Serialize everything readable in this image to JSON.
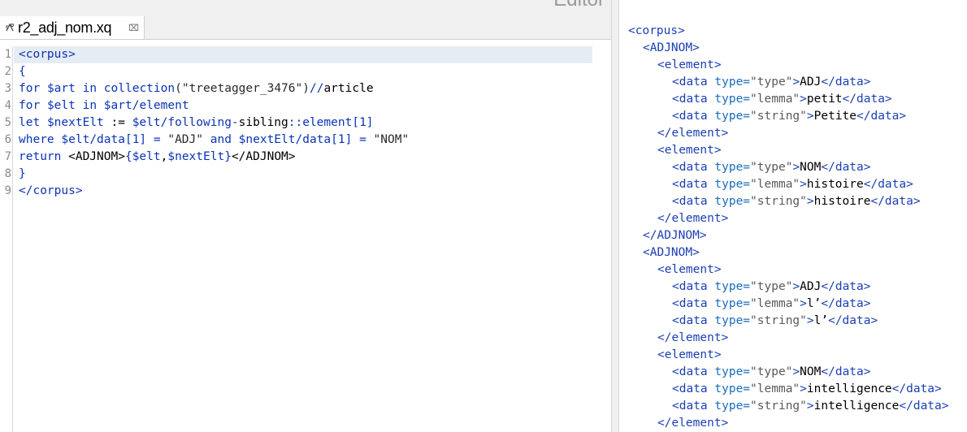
{
  "view_title": "Editor",
  "tab": {
    "label": "r2_adj_nom.xq",
    "close_glyph": "⌧"
  },
  "gutter_numbers": [
    "1",
    "2",
    "3",
    "4",
    "5",
    "6",
    "7",
    "8",
    "9"
  ],
  "code": {
    "l1": {
      "a": "<corpus>"
    },
    "l2": {
      "a": "{"
    },
    "l3": {
      "a": "for",
      "b": " ",
      "c": "$art",
      "d": " ",
      "e": "in",
      "f": " ",
      "g": "collection",
      "h": "(\"treetagger_3476\")",
      "i": "//",
      "j": "article"
    },
    "l4": {
      "a": "for",
      "b": " ",
      "c": "$elt",
      "d": " ",
      "e": "in",
      "f": " ",
      "g": "$art",
      "h": "/",
      "i": "element"
    },
    "l5": {
      "a": "let",
      "b": " ",
      "c": "$nextElt",
      "d": " := ",
      "e": "$elt",
      "f": "/following-",
      "g": "sibling",
      "h": "::element[1]"
    },
    "l6": {
      "a": "where",
      "b": " ",
      "c": "$elt",
      "d": "/data[1] = ",
      "e": "\"ADJ\"",
      "f": " and ",
      "g": "$nextElt",
      "h": "/data[1] = ",
      "i": "\"NOM\""
    },
    "l7": {
      "a": "return",
      "b": " <ADJNOM>",
      "c": "{",
      "d": "$elt",
      "e": ",",
      "f": "$nextElt",
      "g": "}",
      "h": "</ADJNOM>"
    },
    "l8": {
      "a": "}"
    },
    "l9": {
      "a": "</corpus>"
    }
  },
  "output": {
    "corpus_open": "<corpus>",
    "adjnom_open": "<ADJNOM>",
    "adjnom_close": "</ADJNOM>",
    "element_open": "<element>",
    "element_close": "</element>",
    "data_open": "<data",
    "type_attr": " type=",
    "data_close": "</data>",
    "gt": ">",
    "rows": [
      {
        "type": "\"type\"",
        "value": "ADJ"
      },
      {
        "type": "\"lemma\"",
        "value": "petit"
      },
      {
        "type": "\"string\"",
        "value": "Petite"
      },
      {
        "type": "\"type\"",
        "value": "NOM"
      },
      {
        "type": "\"lemma\"",
        "value": "histoire"
      },
      {
        "type": "\"string\"",
        "value": "histoire"
      },
      {
        "type": "\"type\"",
        "value": "ADJ"
      },
      {
        "type": "\"lemma\"",
        "value": "l’"
      },
      {
        "type": "\"string\"",
        "value": "l’"
      },
      {
        "type": "\"type\"",
        "value": "NOM"
      },
      {
        "type": "\"lemma\"",
        "value": "intelligence"
      },
      {
        "type": "\"string\"",
        "value": "intelligence"
      }
    ]
  }
}
